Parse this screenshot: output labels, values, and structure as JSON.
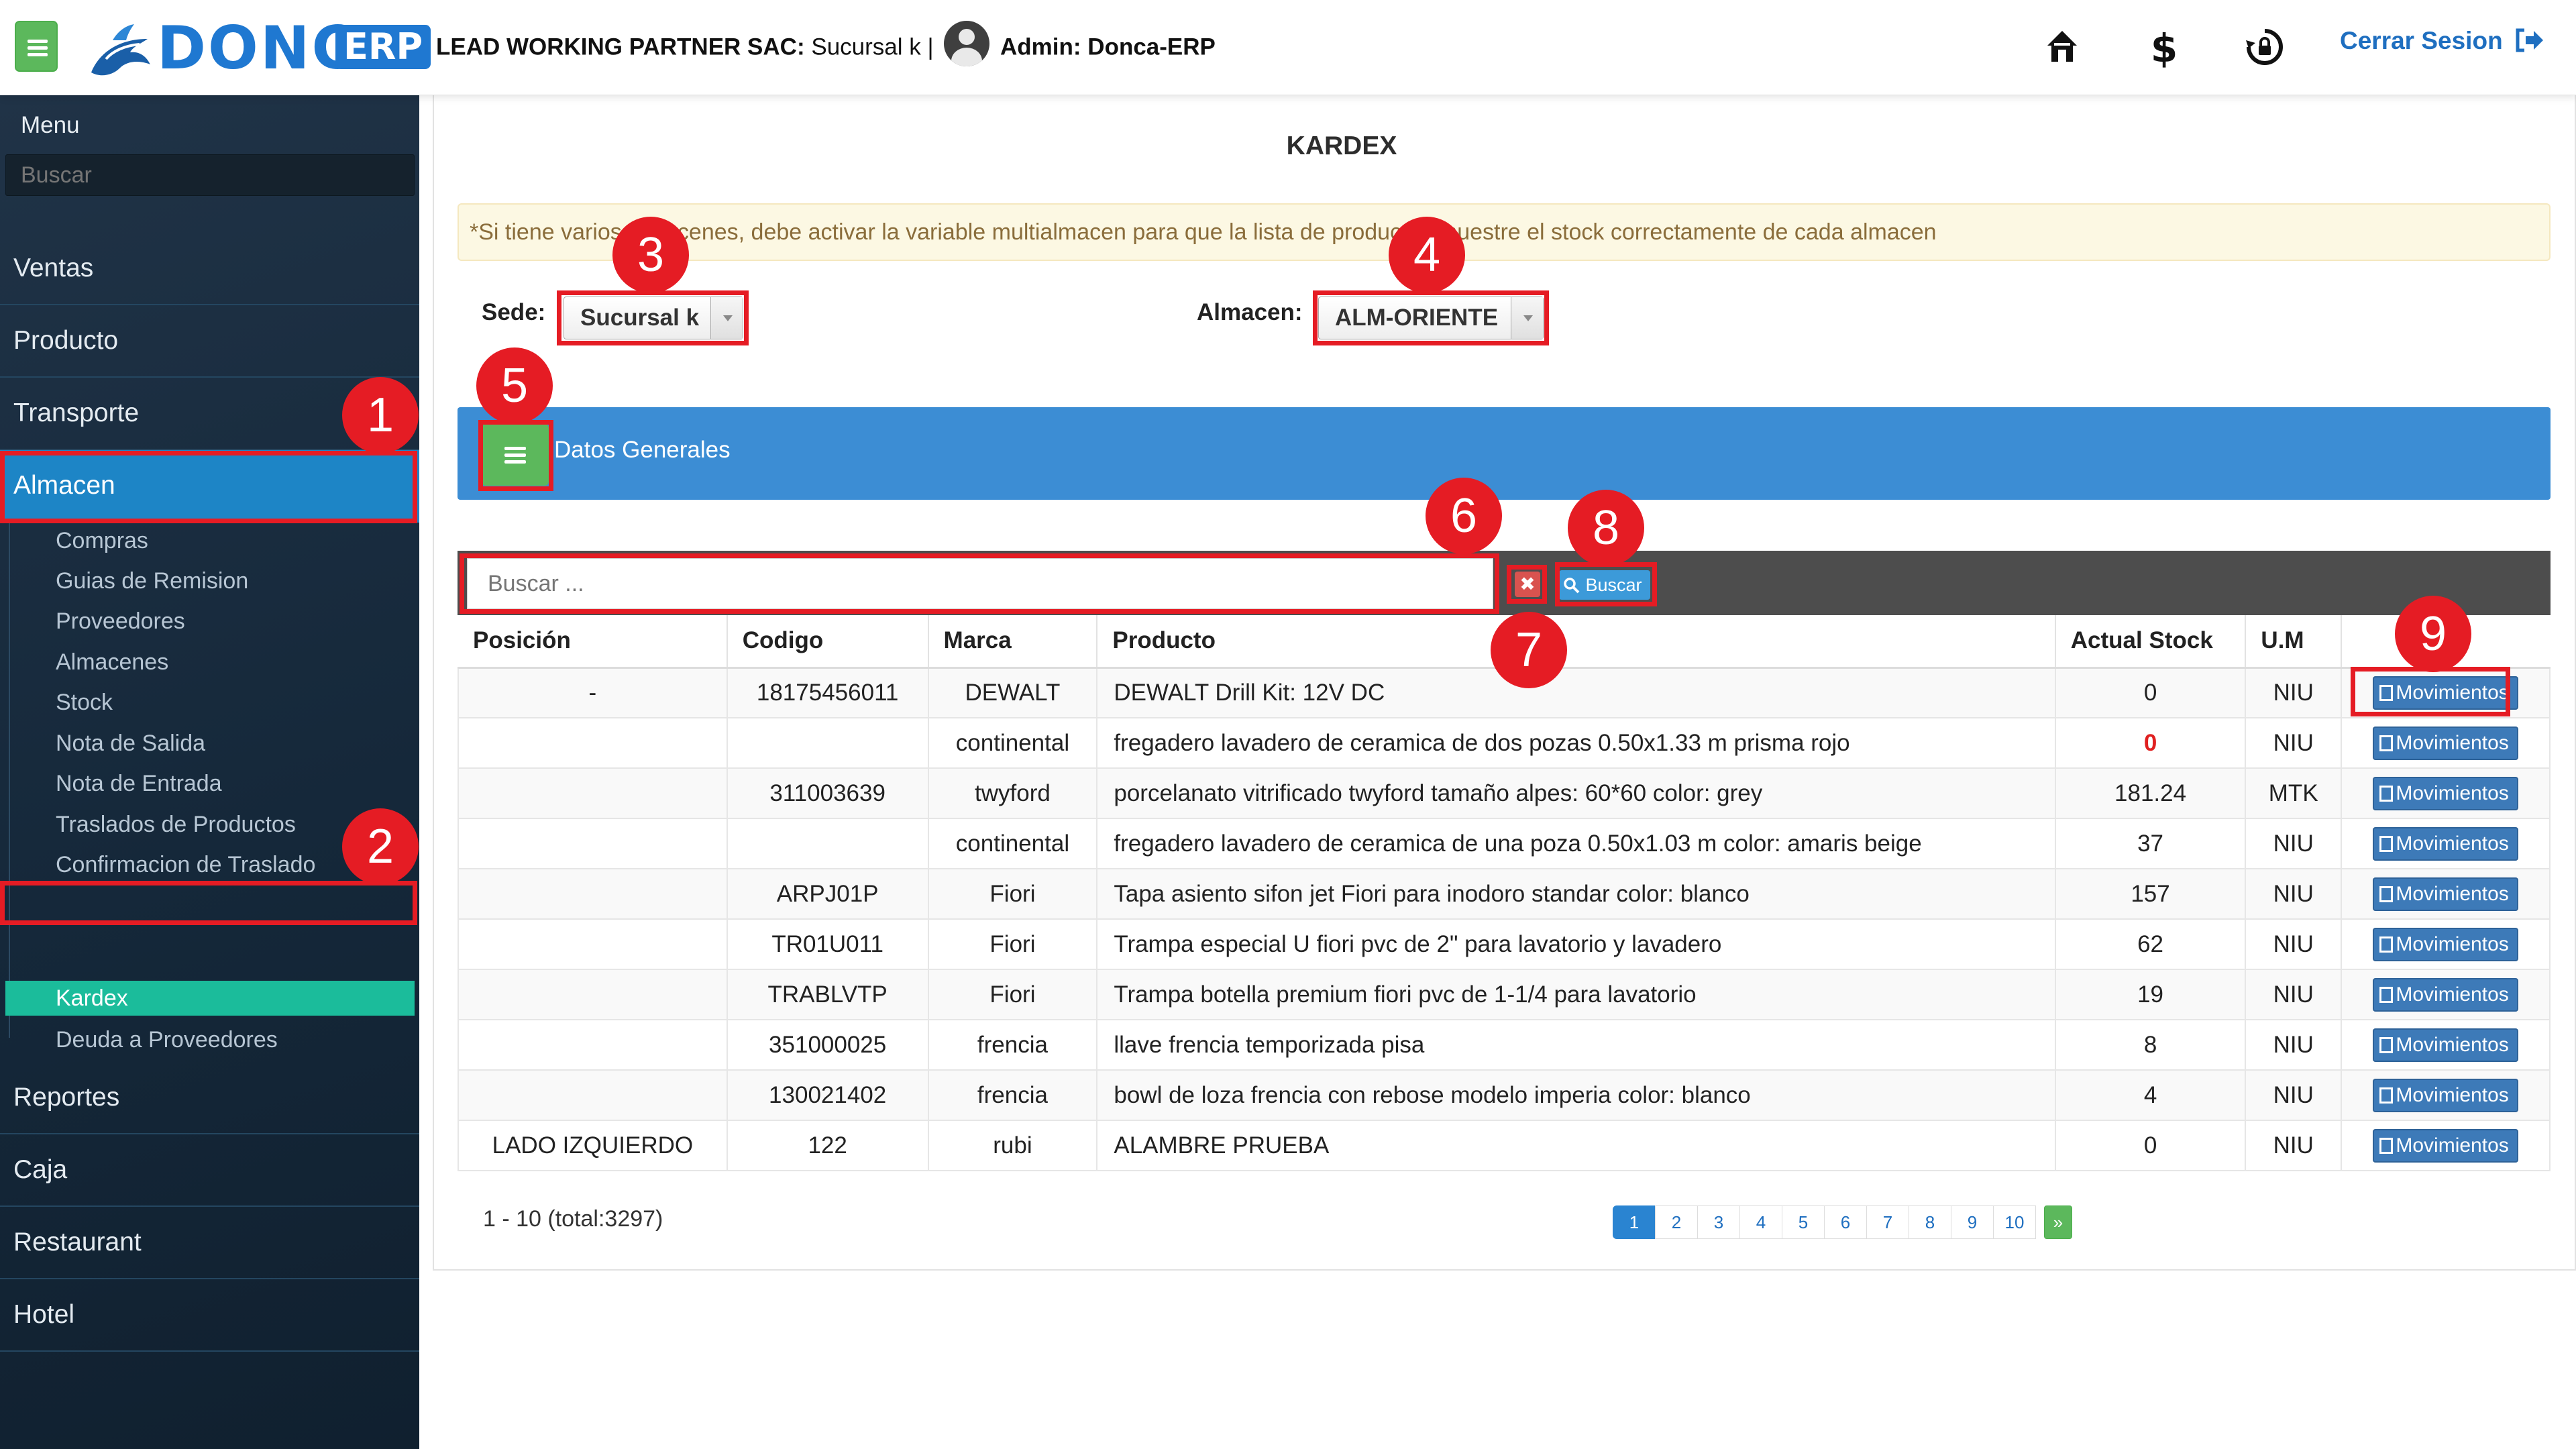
{
  "header": {
    "logo_text": "DONCA",
    "logo_badge": "ERP",
    "company_bold": "LEAD WORKING PARTNER SAC:",
    "branch": "Sucursal k |",
    "admin": "Admin: Donca-ERP",
    "icons": [
      "home-icon",
      "dollar-icon",
      "lock-refresh-icon"
    ],
    "logout_label": "Cerrar Sesion",
    "accent_color": "#1f78d1"
  },
  "sidebar": {
    "menu_label": "Menu",
    "search_placeholder": "Buscar",
    "items": [
      "Ventas",
      "Producto",
      "Transporte",
      "Almacen",
      "Reportes",
      "Caja",
      "Restaurant",
      "Hotel"
    ],
    "active_item": "Almacen",
    "subitems": [
      "Compras",
      "Guias de Remision",
      "Proveedores",
      "Almacenes",
      "Stock",
      "Nota de Salida",
      "Nota de Entrada",
      "Traslados de Productos",
      "Confirmacion de Traslado",
      "Kardex",
      "Deuda a Proveedores"
    ],
    "active_subitem": "Kardex"
  },
  "main": {
    "title": "KARDEX",
    "alert": "*Si tiene varios almacenes, debe activar la variable multialmacen para que la lista de productos muestre el stock correctamente de cada almacen",
    "sede_label": "Sede:",
    "sede_value": "Sucursal k",
    "almacen_label": "Almacen:",
    "almacen_value": "ALM-ORIENTE",
    "section_title": "Datos Generales",
    "search_placeholder": "Buscar ...",
    "buscar_label": "Buscar",
    "columns": [
      "Posición",
      "Codigo",
      "Marca",
      "Producto",
      "Actual Stock",
      "U.M",
      ""
    ],
    "movimientos_label": "Movimientos",
    "rows": [
      {
        "pos": "-",
        "codigo": "18175456011",
        "marca": "DEWALT",
        "producto": "DEWALT Drill Kit: 12V DC",
        "stock": "0",
        "um": "NIU"
      },
      {
        "pos": "",
        "codigo": "",
        "marca": "continental",
        "producto": "fregadero lavadero de ceramica de dos pozas 0.50x1.33 m prisma rojo",
        "stock": "0",
        "um": "NIU"
      },
      {
        "pos": "",
        "codigo": "311003639",
        "marca": "twyford",
        "producto": "porcelanato vitrificado twyford tamaño alpes: 60*60 color: grey",
        "stock": "181.24",
        "um": "MTK"
      },
      {
        "pos": "",
        "codigo": "",
        "marca": "continental",
        "producto": "fregadero lavadero de ceramica de una poza 0.50x1.03 m color: amaris beige",
        "stock": "37",
        "um": "NIU"
      },
      {
        "pos": "",
        "codigo": "ARPJ01P",
        "marca": "Fiori",
        "producto": "Tapa asiento sifon jet Fiori para inodoro standar color: blanco",
        "stock": "157",
        "um": "NIU"
      },
      {
        "pos": "",
        "codigo": "TR01U011",
        "marca": "Fiori",
        "producto": "Trampa especial U fiori pvc de 2\" para lavatorio y lavadero",
        "stock": "62",
        "um": "NIU"
      },
      {
        "pos": "",
        "codigo": "TRABLVTP",
        "marca": "Fiori",
        "producto": "Trampa botella premium fiori pvc de 1-1/4 para lavatorio",
        "stock": "19",
        "um": "NIU"
      },
      {
        "pos": "",
        "codigo": "351000025",
        "marca": "frencia",
        "producto": "llave frencia temporizada pisa",
        "stock": "8",
        "um": "NIU"
      },
      {
        "pos": "",
        "codigo": "130021402",
        "marca": "frencia",
        "producto": "bowl de loza frencia con rebose modelo imperia color: blanco",
        "stock": "4",
        "um": "NIU"
      },
      {
        "pos": "LADO IZQUIERDO",
        "codigo": "122",
        "marca": "rubi",
        "producto": "ALAMBRE PRUEBA",
        "stock": "0",
        "um": "NIU"
      }
    ],
    "total_text": "1 - 10 (total:3297)",
    "pages": [
      "1",
      "2",
      "3",
      "4",
      "5",
      "6",
      "7",
      "8",
      "9",
      "10"
    ],
    "current_page": "1",
    "next_label": "»"
  },
  "callouts": [
    "1",
    "2",
    "3",
    "4",
    "5",
    "6",
    "7",
    "8",
    "9"
  ],
  "colors": {
    "callout": "#e51c24",
    "sidebar_active": "#1d85c6",
    "kardex_active": "#1bbc9b",
    "section_bar": "#3c8dd4",
    "green_button": "#5cb85c"
  }
}
